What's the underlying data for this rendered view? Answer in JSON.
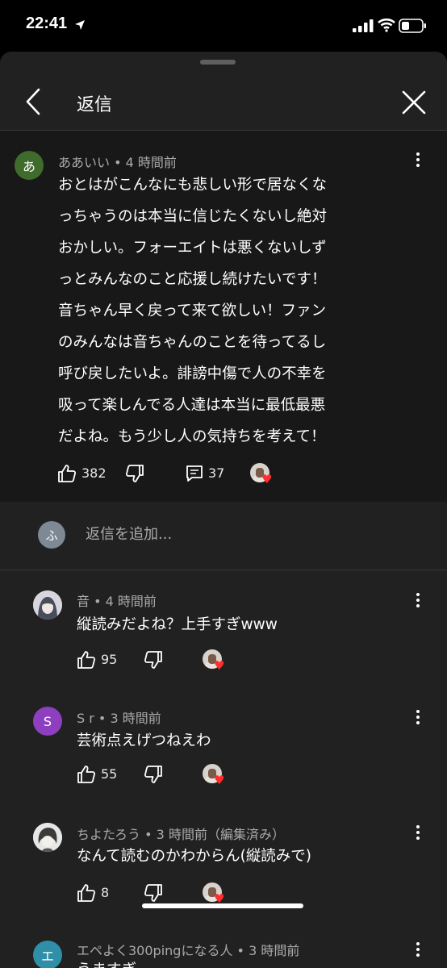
{
  "status": {
    "time": "22:41"
  },
  "header": {
    "title": "返信"
  },
  "parent": {
    "avatar_letter": "あ",
    "avatar_color": "#3f6b2c",
    "author": "ああいい",
    "time": "4 時間前",
    "lines": [
      "おとはがこんなにも悲しい形で居なくな",
      "っちゃうのは本当に信じたくないし絶対",
      "おかしい。フォーエイトは悪くないしず",
      "っとみんなのこと応援し続けたいです！",
      "音ちゃん早く戻って来て欲しい！ファン",
      "のみんなは音ちゃんのことを待ってるし",
      "呼び戻したいよ。誹謗中傷で人の不幸を",
      "吸って楽しんでる人達は本当に最低最悪",
      "だよね。もう少し人の気持ちを考えて！"
    ],
    "likes": "382",
    "replies": "37"
  },
  "reply_input": {
    "avatar_letter": "ふ",
    "avatar_color": "#7d8a96",
    "placeholder": "返信を追加..."
  },
  "replies": [
    {
      "author": "音",
      "time": "4 時間前",
      "text": "縦読みだよね？上手すぎwww",
      "likes": "95"
    },
    {
      "author": "S r",
      "avatar_letter": "S",
      "avatar_color": "#8e3fbf",
      "time": "3 時間前",
      "text": "芸術点えげつねえわ",
      "likes": "55"
    },
    {
      "author": "ちよたろう",
      "time": "3 時間前（編集済み）",
      "text": "なんて読むのかわからん(縦読みで)",
      "likes": "8"
    },
    {
      "author": "エペよく300pingになる人",
      "avatar_letter": "エ",
      "avatar_color": "#2f8fa8",
      "time": "3 時間前",
      "text": "うますぎ"
    }
  ],
  "separator": "•"
}
